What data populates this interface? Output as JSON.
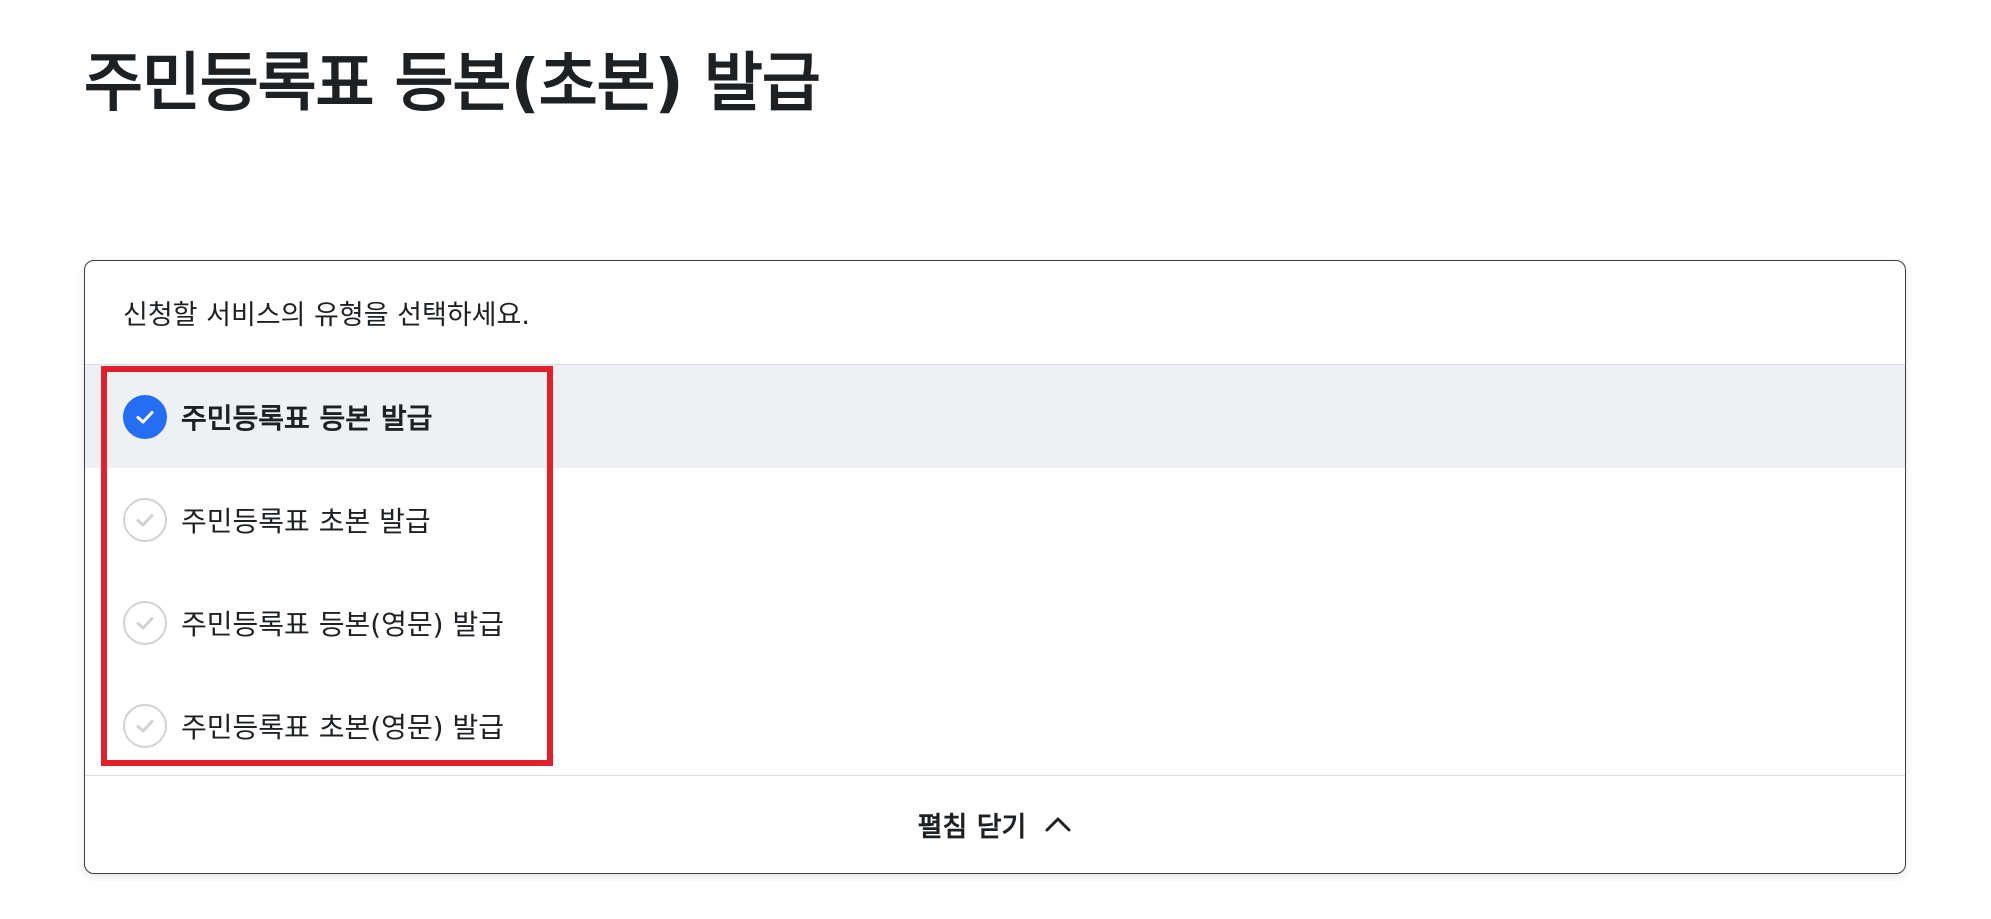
{
  "page": {
    "title": "주민등록표 등본(초본) 발급"
  },
  "service_select": {
    "prompt": "신청할 서비스의 유형을 선택하세요.",
    "options": [
      {
        "label": "주민등록표 등본 발급",
        "selected": true
      },
      {
        "label": "주민등록표 초본 발급",
        "selected": false
      },
      {
        "label": "주민등록표 등본(영문) 발급",
        "selected": false
      },
      {
        "label": "주민등록표 초본(영문) 발급",
        "selected": false
      }
    ],
    "collapse_label": "펼침 닫기"
  },
  "colors": {
    "accent": "#256ef4",
    "selected_row_bg": "#eef0f4",
    "highlight": "#e0202b",
    "unchecked_mark": "#cfd2d6"
  },
  "icons": {
    "checked": "check-circle-filled-icon",
    "unchecked": "check-circle-outline-icon",
    "collapse": "chevron-up-icon"
  }
}
